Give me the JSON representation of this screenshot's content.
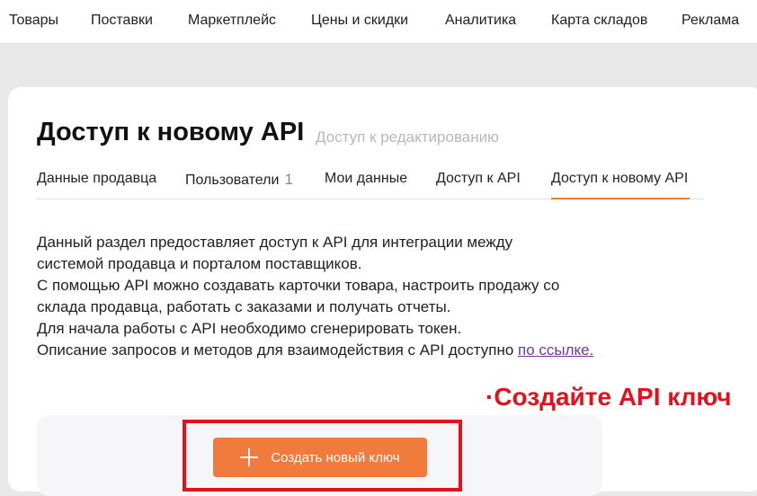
{
  "topnav": {
    "items": [
      "Товары",
      "Поставки",
      "Маркетплейс",
      "Цены и скидки",
      "Аналитика",
      "Карта складов",
      "Реклама"
    ]
  },
  "page": {
    "title": "Доступ к новому API",
    "subtitle": "Доступ к редактированию"
  },
  "tabs": {
    "items": [
      {
        "label": "Данные продавца"
      },
      {
        "label": "Пользователи",
        "count": "1"
      },
      {
        "label": "Мои данные"
      },
      {
        "label": "Доступ к API"
      },
      {
        "label": "Доступ к новому API",
        "active": true
      }
    ]
  },
  "description": {
    "lines": [
      "Данный раздел предоставляет доступ к API для интеграции между",
      "системой продавца и порталом поставщиков.",
      "С помощью API можно создавать карточки товара, настроить продажу со",
      "склада продавца, работать с заказами и получать отчеты.",
      "Для начала работы с API необходимо сгенерировать токен."
    ],
    "last_line_text": "Описание запросов и методов для взаимодействия с API доступно ",
    "link_text": "по ссылке."
  },
  "annotation": "·Создайте API ключ",
  "create_button": {
    "label": "Создать новый ключ",
    "icon": "plus-icon"
  },
  "colors": {
    "accent": "#f07b3d",
    "annotation_red": "#e3111b",
    "link": "#6a3aa0"
  }
}
